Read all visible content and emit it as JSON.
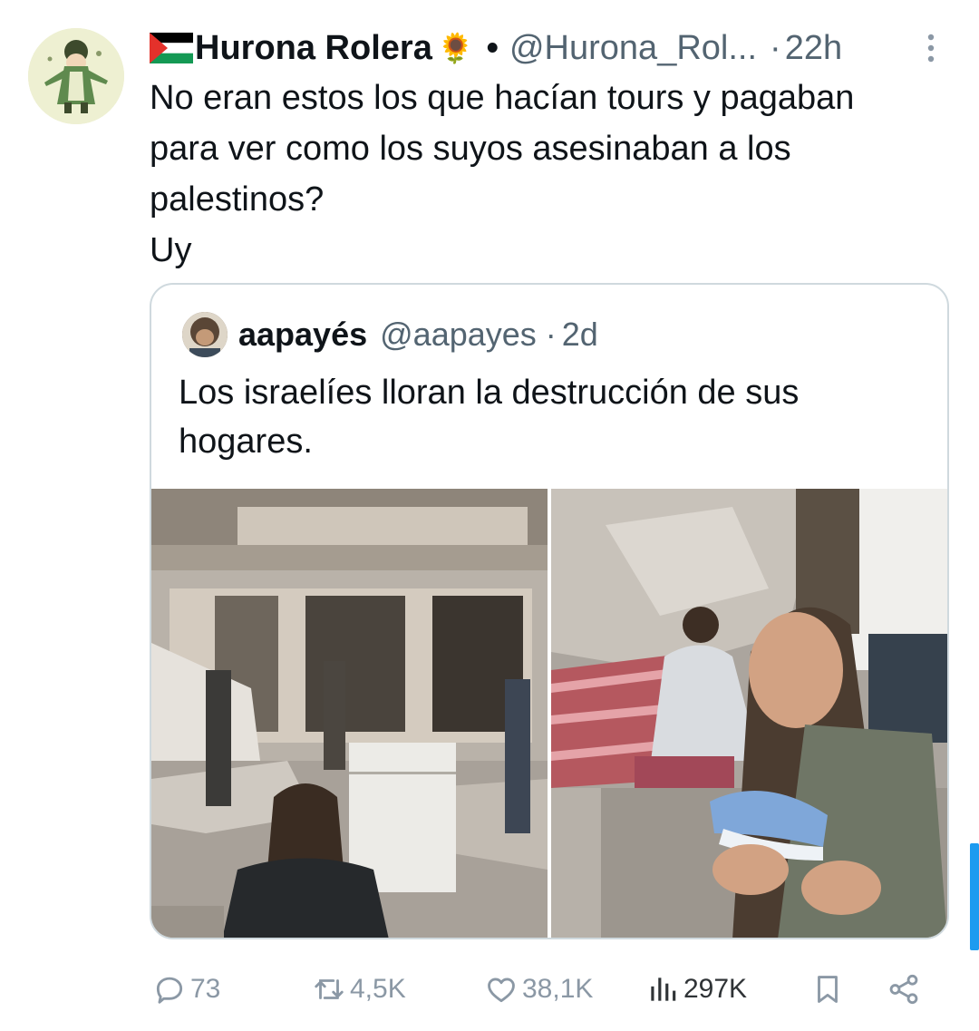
{
  "tweet": {
    "author": {
      "display_name": "Hurona Rolera",
      "emoji": "🌻",
      "handle": "@Hurona_Rol...",
      "flag_icon": "palestine-flag-icon"
    },
    "separator": "•",
    "time_separator": "·",
    "time": "22h",
    "text": "No eran estos los que hacían tours y pagaban\npara ver como los suyos asesinaban a los\npalestinos?\nUy"
  },
  "quote": {
    "author": {
      "display_name": "aapayés",
      "handle": "@aapayes"
    },
    "time_separator": "·",
    "time": "2d",
    "text": "Los israelíes lloran la destrucción de sus hogares.",
    "media": [
      "photo-left",
      "photo-right"
    ]
  },
  "actions": {
    "replies": "73",
    "retweets": "4,5K",
    "likes": "38,1K",
    "views": "297K"
  },
  "colors": {
    "text": "#0f1419",
    "secondary": "#536471",
    "action_gray": "#8b98a5",
    "border": "#cfd9de",
    "accent": "#1d9bf0"
  }
}
